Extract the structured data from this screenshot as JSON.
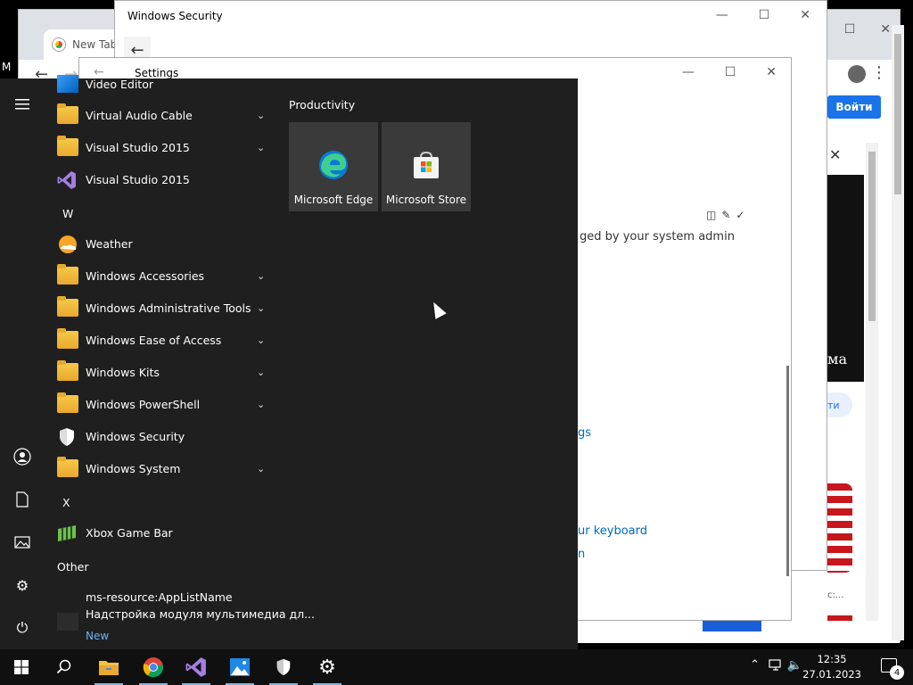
{
  "chrome": {
    "tab_label": "New Tab",
    "signin_label": "Войти",
    "ad_text": "ма",
    "pill_text": "ти",
    "small_text": "с:..."
  },
  "security_window": {
    "title": "Windows Security"
  },
  "settings_window": {
    "title": "Settings",
    "managed_text": "ged by your system admin",
    "link_gs": "gs",
    "link_keyboard": "ur keyboard",
    "link_n": "n"
  },
  "edge": {
    "m_text": "M"
  },
  "start_menu": {
    "apps": [
      {
        "label": "Video Editor",
        "icon": "video-editor-icon"
      },
      {
        "label": "Virtual Audio Cable",
        "icon": "folder-icon",
        "expandable": true
      },
      {
        "label": "Visual Studio 2015",
        "icon": "folder-icon",
        "expandable": true
      },
      {
        "label": "Visual Studio 2015",
        "icon": "visual-studio-icon"
      },
      {
        "letter": "W"
      },
      {
        "label": "Weather",
        "icon": "weather-icon"
      },
      {
        "label": "Windows Accessories",
        "icon": "folder-icon",
        "expandable": true
      },
      {
        "label": "Windows Administrative Tools",
        "icon": "folder-icon",
        "expandable": true
      },
      {
        "label": "Windows Ease of Access",
        "icon": "folder-icon",
        "expandable": true
      },
      {
        "label": "Windows Kits",
        "icon": "folder-icon",
        "expandable": true
      },
      {
        "label": "Windows PowerShell",
        "icon": "folder-icon",
        "expandable": true
      },
      {
        "label": "Windows Security",
        "icon": "shield-icon"
      },
      {
        "label": "Windows System",
        "icon": "folder-icon",
        "expandable": true
      },
      {
        "letter": "X"
      },
      {
        "label": "Xbox Game Bar",
        "icon": "xbox-game-bar-icon"
      },
      {
        "section": "Other"
      },
      {
        "label": "ms-resource:AppListName",
        "icon": "blank-icon"
      },
      {
        "label": "Надстройка модуля мультимедиа дл...",
        "icon": "media-module-icon",
        "badge": "New"
      }
    ],
    "tile_group": "Productivity",
    "tiles": [
      {
        "label": "Microsoft Edge",
        "icon": "edge-icon"
      },
      {
        "label": "Microsoft Store",
        "icon": "store-icon"
      }
    ]
  },
  "taskbar": {
    "apps": [
      "start-icon",
      "search-icon",
      "file-explorer-icon",
      "chrome-icon",
      "visual-studio-icon",
      "photos-icon",
      "shield-icon",
      "settings-icon"
    ],
    "time": "12:35",
    "date": "27.01.2023",
    "notification_count": "4"
  },
  "colors": {
    "start_bg": "#1f1f1f",
    "tile_bg": "#3a3a3a",
    "taskbar_bg": "#101010",
    "accent": "#76b9ed",
    "link": "#0067c0"
  }
}
